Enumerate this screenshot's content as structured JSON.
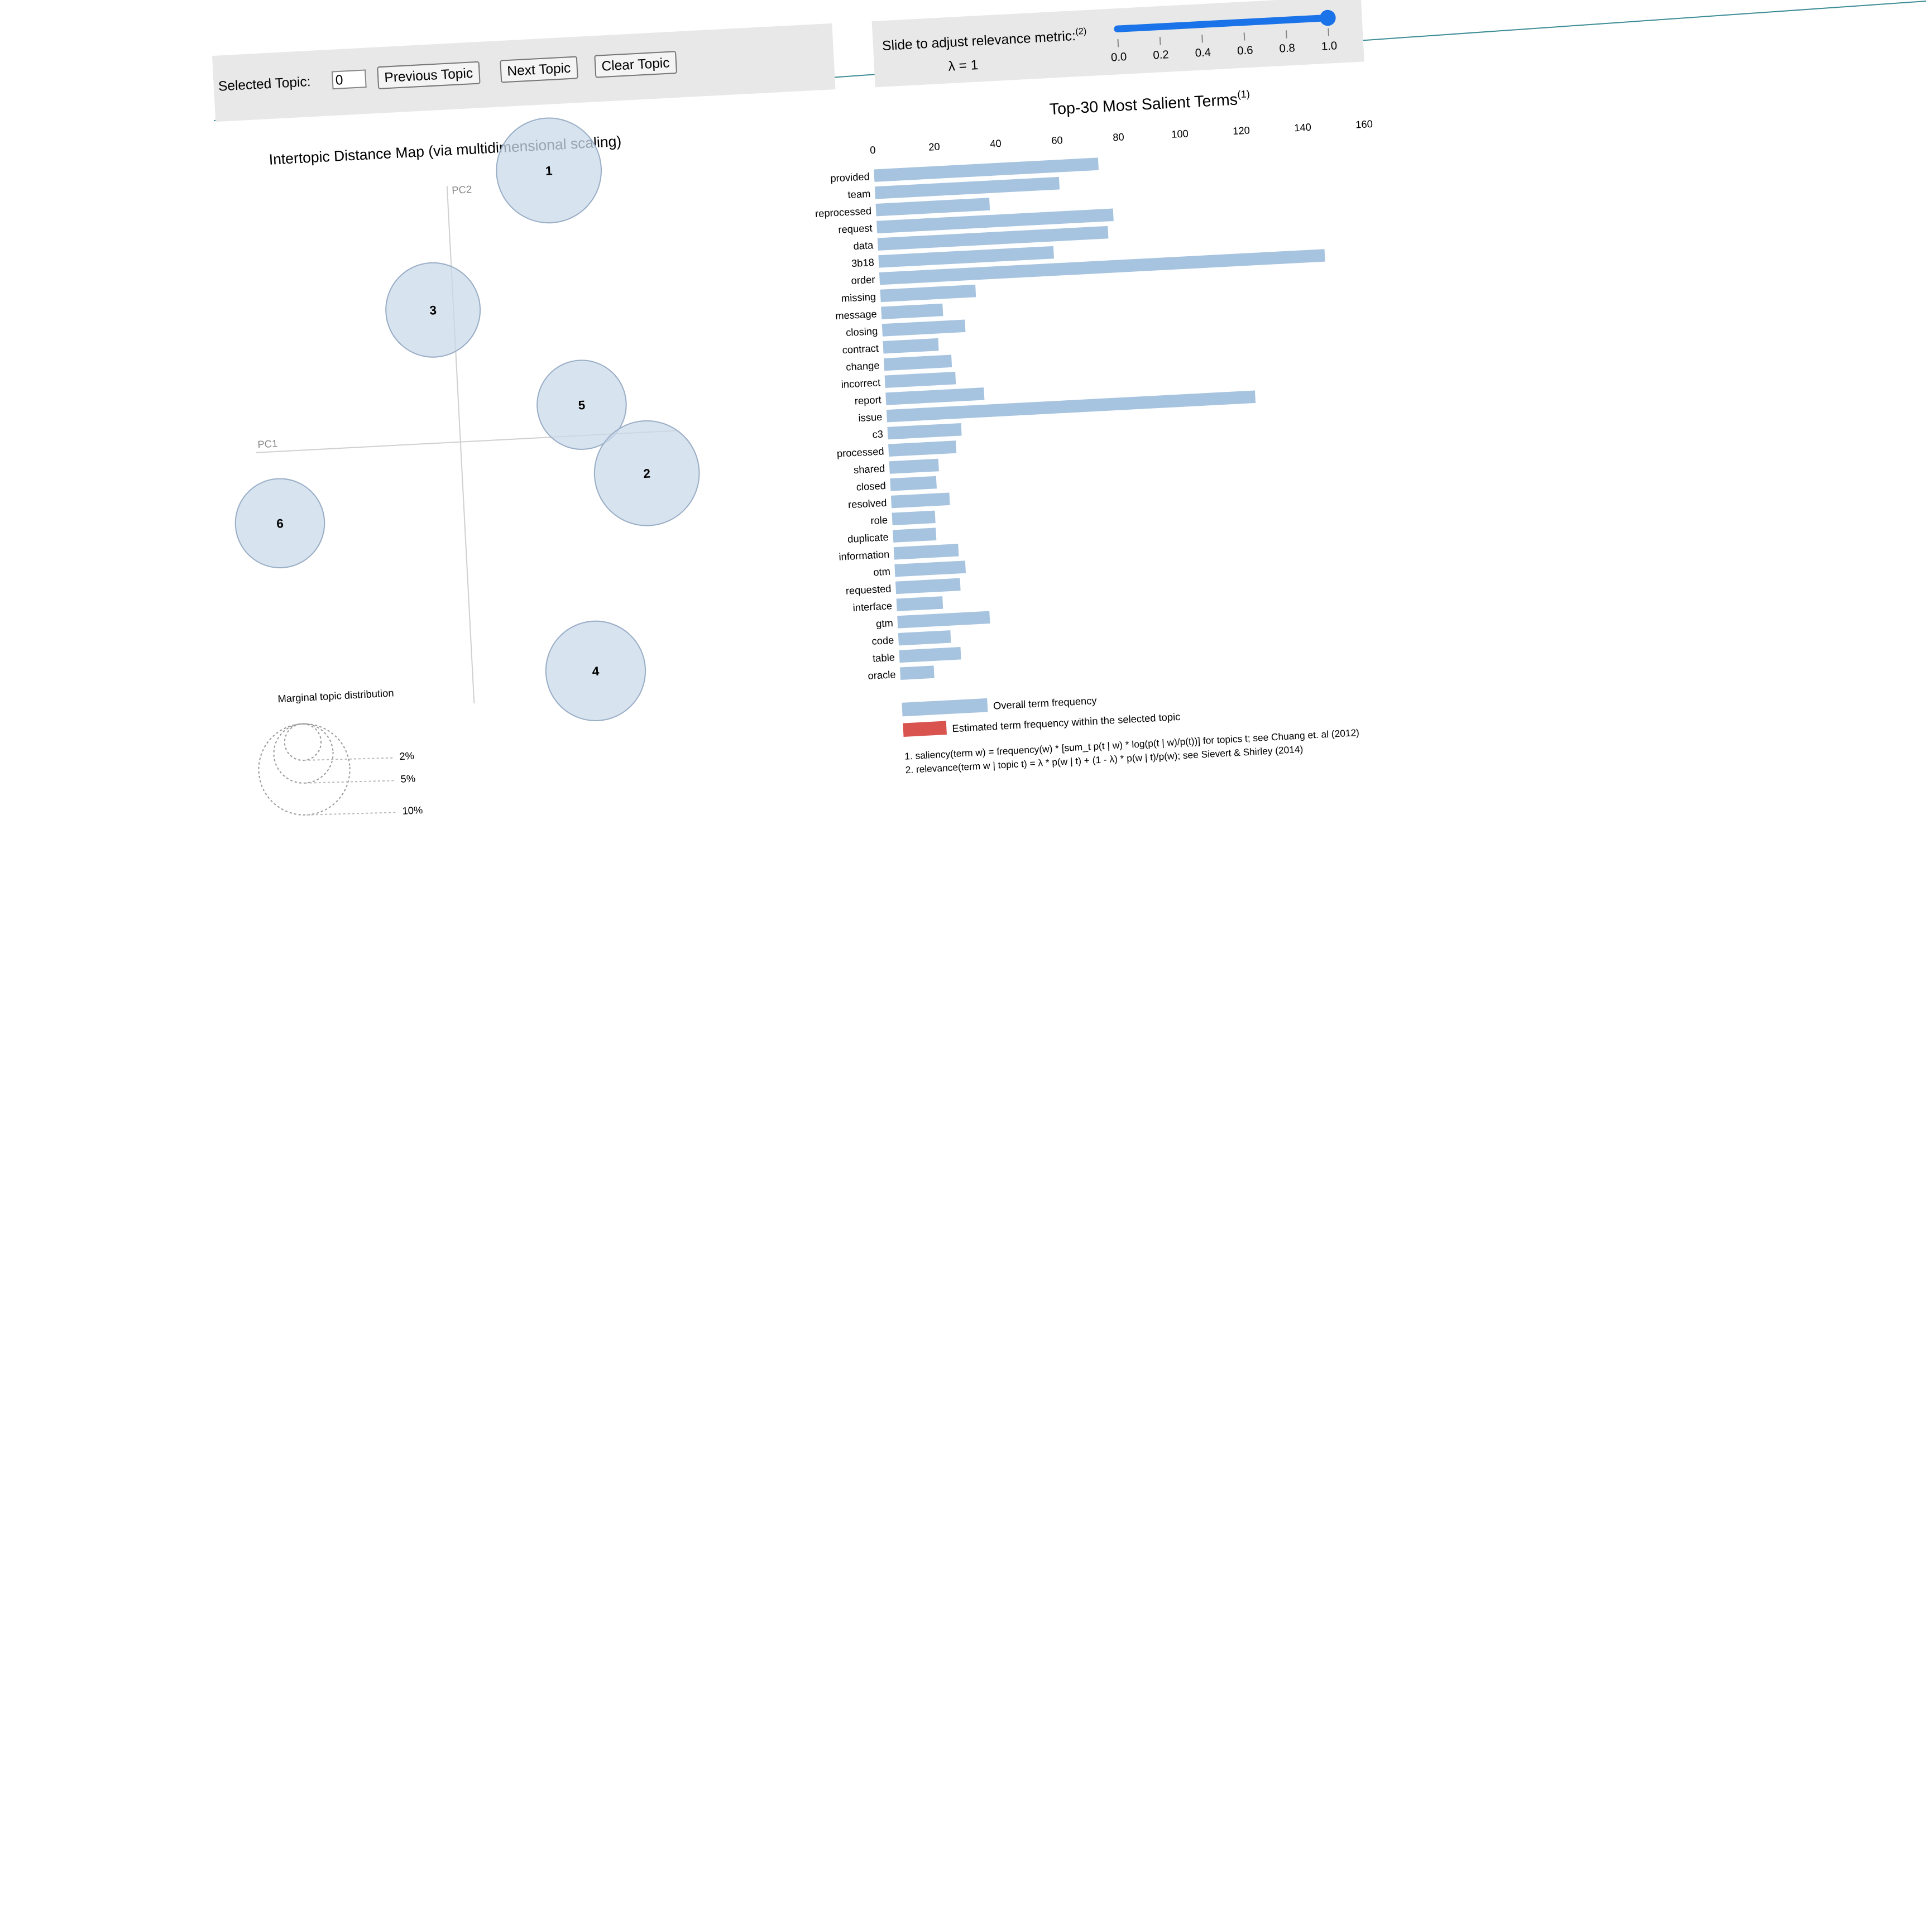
{
  "controls": {
    "selected_topic_label": "Selected Topic:",
    "selected_topic_value": "0",
    "previous_label": "Previous Topic",
    "next_label": "Next Topic",
    "clear_label": "Clear Topic",
    "slider_label": "Slide to adjust relevance metric:",
    "slider_footnote": "(2)",
    "lambda_text": "λ = 1",
    "slider_value": 1.0,
    "slider_ticks": [
      "0.0",
      "0.2",
      "0.4",
      "0.6",
      "0.8",
      "1.0"
    ]
  },
  "colors": {
    "bar_overall": "#a6c3df",
    "bar_topic": "#d9534f",
    "circle_fill": "#c9d9ea",
    "circle_stroke": "#9aaec6",
    "slider_accent": "#1a73e8",
    "panel_bg": "#e8e8e8"
  },
  "chart_data": [
    {
      "type": "scatter",
      "title": "Intertopic Distance Map (via multidimensional scaling)",
      "xlabel": "PC1",
      "ylabel": "PC2",
      "points": [
        {
          "label": "1",
          "x": 0.1,
          "y": 0.26,
          "size": 0.2
        },
        {
          "label": "3",
          "x": -0.02,
          "y": 0.13,
          "size": 0.18
        },
        {
          "label": "5",
          "x": 0.12,
          "y": 0.03,
          "size": 0.17
        },
        {
          "label": "2",
          "x": 0.18,
          "y": -0.04,
          "size": 0.2
        },
        {
          "label": "6",
          "x": -0.18,
          "y": -0.07,
          "size": 0.17
        },
        {
          "label": "4",
          "x": 0.12,
          "y": -0.23,
          "size": 0.19
        }
      ],
      "marginal_legend": {
        "title": "Marginal topic distribution",
        "levels": [
          "2%",
          "5%",
          "10%"
        ]
      }
    },
    {
      "type": "bar",
      "orientation": "horizontal",
      "title": "Top-30 Most Salient Terms",
      "title_footnote": "(1)",
      "xlim": [
        0,
        160
      ],
      "xticks": [
        "0",
        "20",
        "40",
        "60",
        "80",
        "100",
        "120",
        "140",
        "160"
      ],
      "categories": [
        "provided",
        "team",
        "reprocessed",
        "request",
        "data",
        "3b18",
        "order",
        "missing",
        "message",
        "closing",
        "contract",
        "change",
        "incorrect",
        "report",
        "issue",
        "c3",
        "processed",
        "shared",
        "closed",
        "resolved",
        "role",
        "duplicate",
        "information",
        "otm",
        "requested",
        "interface",
        "gtm",
        "code",
        "table",
        "oracle"
      ],
      "values": [
        73,
        60,
        37,
        77,
        75,
        57,
        145,
        31,
        20,
        27,
        18,
        22,
        23,
        32,
        120,
        24,
        22,
        16,
        15,
        19,
        14,
        14,
        21,
        23,
        21,
        15,
        30,
        17,
        20,
        11
      ],
      "legend": [
        "Overall term frequency",
        "Estimated term frequency within the selected topic"
      ],
      "footnotes": [
        "1. saliency(term w) = frequency(w) * [sum_t p(t | w) * log(p(t | w)/p(t))] for topics t; see Chuang et. al (2012)",
        "2. relevance(term w | topic t) = λ * p(w | t) + (1 - λ) * p(w | t)/p(w); see Sievert & Shirley (2014)"
      ]
    }
  ]
}
